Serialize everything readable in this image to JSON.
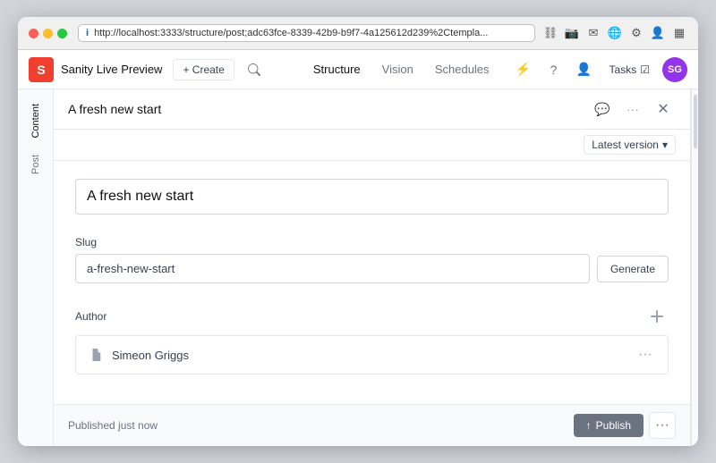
{
  "browser": {
    "url": "http://localhost:3333/structure/post;adc63fce-8339-42b9-b9f7-4a125612d239%2Ctempla...",
    "info_icon": "i"
  },
  "app": {
    "logo_letter": "S",
    "name": "Sanity Live Preview",
    "create_label": "+ Create",
    "search_placeholder": "Search"
  },
  "nav": {
    "links": [
      {
        "label": "Structure",
        "active": true
      },
      {
        "label": "Vision",
        "active": false
      },
      {
        "label": "Schedules",
        "active": false
      }
    ]
  },
  "header_actions": {
    "tasks_label": "Tasks",
    "avatar_initials": "SG"
  },
  "side_tabs": [
    {
      "label": "Content",
      "active": true
    },
    {
      "label": "Post",
      "active": false
    }
  ],
  "document": {
    "title": "A fresh new start",
    "version_label": "Latest version",
    "fields": {
      "title_value": "A fresh new start",
      "slug_label": "Slug",
      "slug_value": "a-fresh-new-start",
      "generate_btn_label": "Generate",
      "author_label": "Author",
      "author_name": "Simeon Griggs"
    }
  },
  "status_bar": {
    "published_text": "Published just now",
    "publish_btn_label": "Publish",
    "publish_icon": "↑"
  }
}
